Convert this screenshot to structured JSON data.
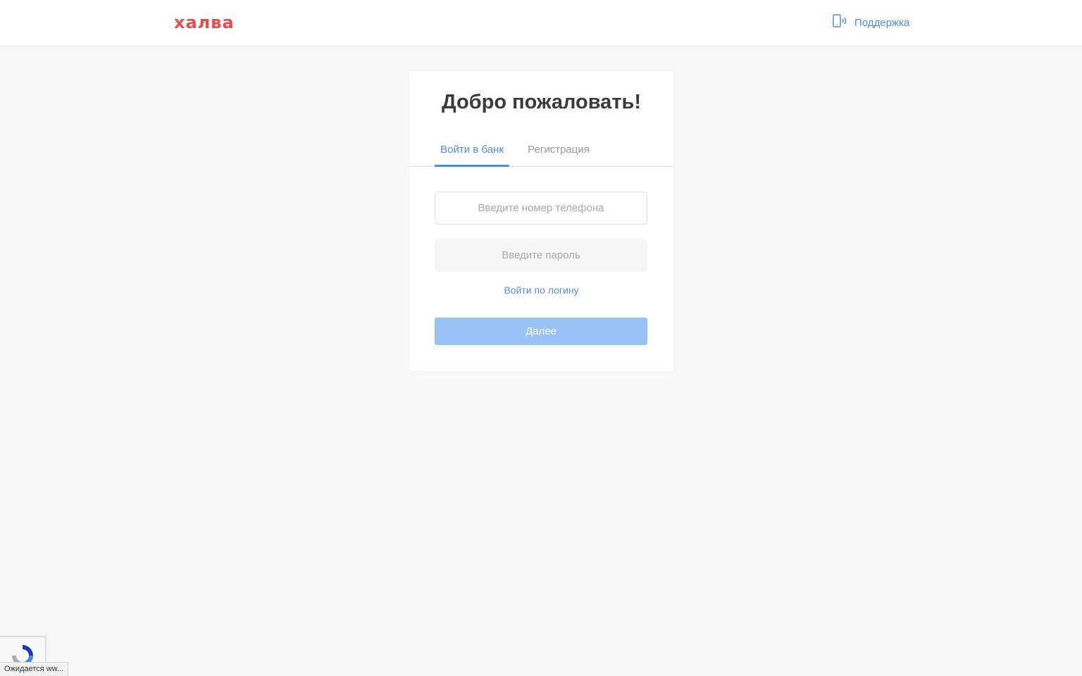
{
  "header": {
    "logo_text": "халва",
    "support_label": "Поддержка"
  },
  "card": {
    "title": "Добро пожаловать!",
    "tabs": [
      {
        "label": "Войти в банк",
        "active": true
      },
      {
        "label": "Регистрация",
        "active": false
      }
    ],
    "phone_field": {
      "value": "",
      "placeholder": "Введите номер телефона"
    },
    "password_field": {
      "value": "",
      "placeholder": "Введите пароль"
    },
    "login_link": "Войти по логину",
    "next_button": "Далее"
  },
  "browser": {
    "status_text": "Ожидается ww..."
  },
  "colors": {
    "brand": "#e94b4b",
    "accent": "#4f8de0",
    "button_disabled": "#99c3f7",
    "background": "#f8f8f8"
  },
  "icons": {
    "support": "phone-vibrate-icon",
    "recaptcha": "recaptcha-icon"
  }
}
